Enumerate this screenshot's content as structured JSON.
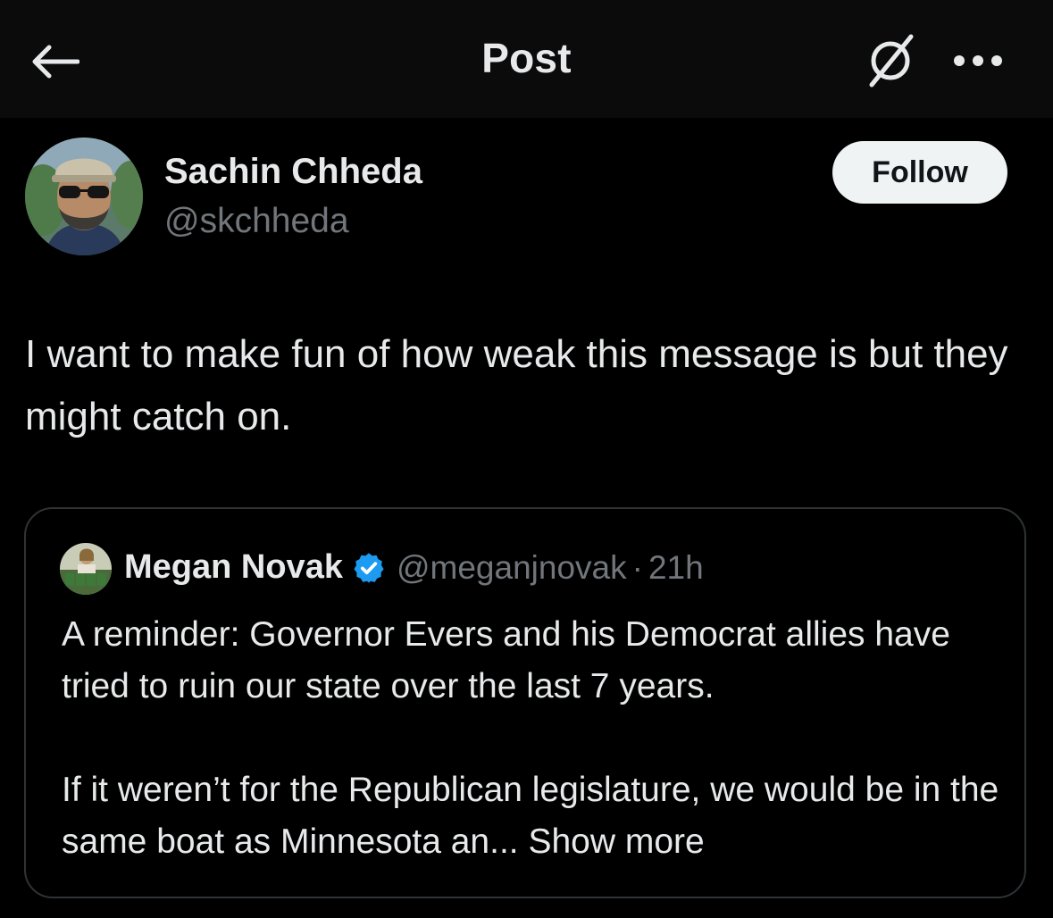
{
  "header": {
    "title": "Post",
    "back_icon": "arrow-left-icon",
    "grok_icon": "grok-icon",
    "more_icon": "more-horizontal-icon"
  },
  "post": {
    "author_name": "Sachin Chheda",
    "author_handle": "@skchheda",
    "follow_label": "Follow",
    "text": "I want to make fun of how weak this message is but they might catch on."
  },
  "quote": {
    "author_name": "Megan Novak",
    "verified_icon": "verified-badge-icon",
    "author_handle": "@meganjnovak",
    "separator": "·",
    "time": "21h",
    "paragraph1": "A reminder: Governor Evers and his Democrat allies have tried to ruin our state over the last 7 years.",
    "paragraph2": "If it weren’t for the Republican legislature, we would be in the same boat as Minnesota an...",
    "show_more": "Show more"
  },
  "colors": {
    "background": "#000000",
    "topbar": "#0b0b0b",
    "text_primary": "#e7e9ea",
    "text_secondary": "#71767b",
    "border": "#2f3336",
    "verified": "#1d9bf0",
    "follow_bg": "#eff3f4"
  }
}
